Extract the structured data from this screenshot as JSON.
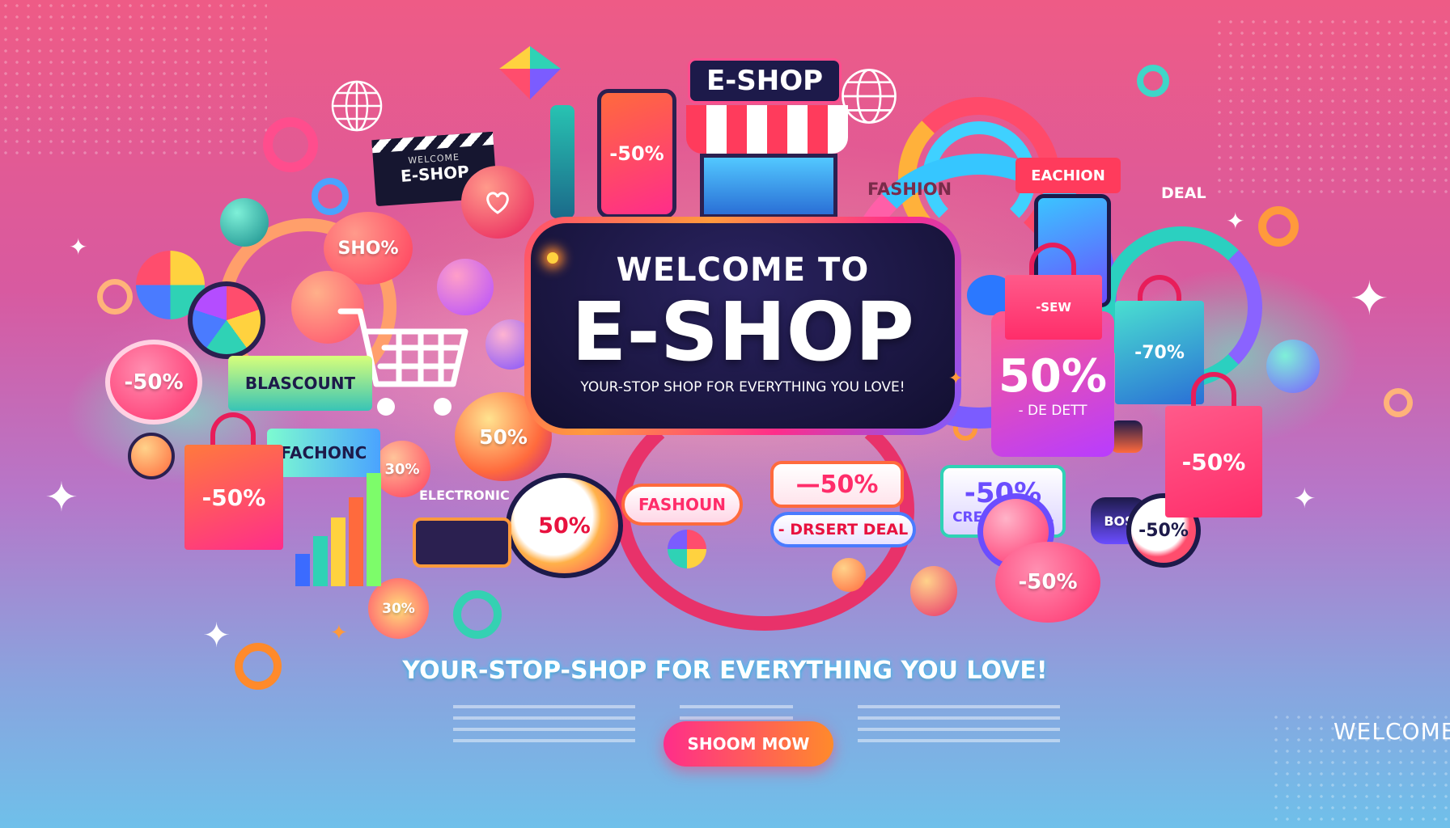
{
  "hero": {
    "title_top": "WELCOME TO",
    "title_main": "E-SHOP",
    "panel_tagline": "YOUR-STOP SHOP FOR EVERYTHING YOU LOVE!"
  },
  "store_sign": "E-SHOP",
  "clapper": {
    "line1": "WELCOME",
    "line2": "E-SHOP"
  },
  "tagline": "YOUR-STOP-SHOP FOR EVERYTHING YOU LOVE!",
  "cta_button": "SHOOM MOW",
  "corner_text": "WELCOME",
  "labels": {
    "shop_bubble": "SHO%",
    "phone_sale": "-50%",
    "bubble_50_left": "-50%",
    "blascount": "BLASCOUNT",
    "fachionc": "FACHONC",
    "electronic": "ELECTRONIC",
    "bag_left": "-50%",
    "bubble_30": "30%",
    "bubble_50_mid": "50%",
    "bubble_50_center": "50%",
    "fashoun": "FASHOUN",
    "tag_50_wide": "—50%",
    "dessert_deal": "- DRSERT DEAL",
    "credit_50": "-50%",
    "credit_deal": "CREDIT DEAL",
    "ring_50": "-50%",
    "bubble_50_lower": "-50%",
    "big_50": "50%",
    "de_dett": "- DE DETT",
    "bag_right": "-50%",
    "bag_mid_sale": "-70%",
    "fashion": "FASHION",
    "eachion": "EACHION",
    "deal": "DEAL",
    "cloud_30": "30%",
    "small_bag": "BOS",
    "pink_bag_sale": "-SEW"
  },
  "colors": {
    "accent_pink": "#ff2d8a",
    "accent_orange": "#ff8a2b",
    "panel_navy": "#1a1540",
    "sale_red": "#e8123f"
  }
}
